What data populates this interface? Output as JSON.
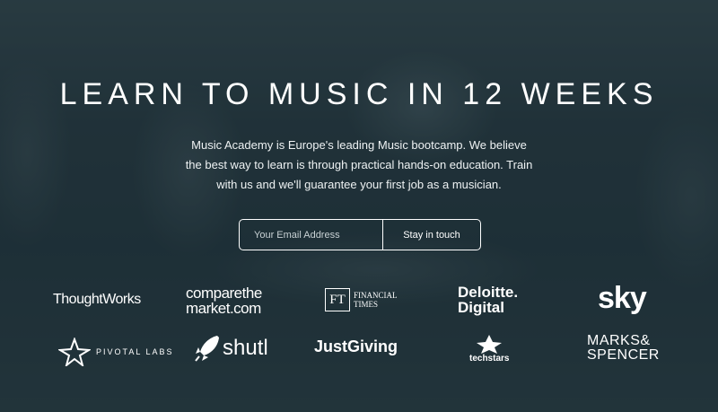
{
  "hero": {
    "title": "LEARN TO MUSIC IN 12 WEEKS",
    "subtitle_lines": [
      "Music Academy is Europe's leading Music bootcamp. We believe",
      "the best way to learn is through practical hands-on education. Train",
      "with us and we'll guarantee your first job as a musician."
    ]
  },
  "signup": {
    "email_placeholder": "Your Email Address",
    "button_label": "Stay in touch"
  },
  "logos": {
    "thoughtworks": "ThoughtWorks",
    "comparethemarket_line1": "comparethe",
    "comparethemarket_line2": "market.com",
    "ft_mark": "FT",
    "ft_line1": "FINANCIAL",
    "ft_line2": "TIMES",
    "deloitte_line1": "Deloitte.",
    "deloitte_line2": "Digital",
    "sky": "sky",
    "pivotal": "PIVOTAL LABS",
    "shutl": "shutl",
    "justgiving": "JustGiving",
    "techstars": "techstars",
    "ms_line1": "MARKS&",
    "ms_line2": "SPENCER"
  }
}
